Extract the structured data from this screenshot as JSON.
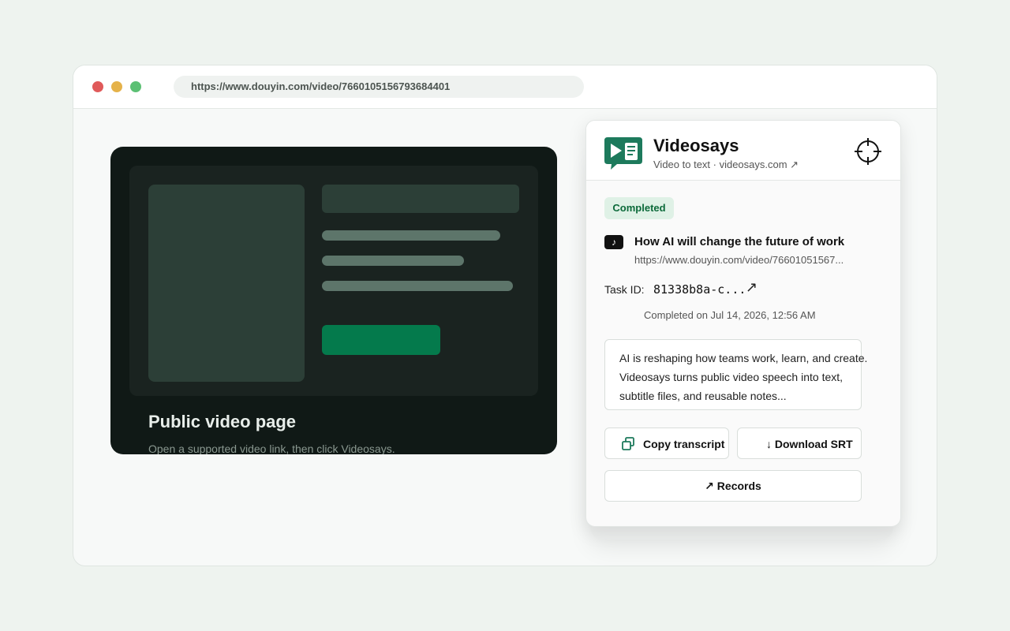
{
  "browser": {
    "url": "https://www.douyin.com/video/7660105156793684401"
  },
  "page": {
    "title": "Public video page",
    "subtitle": "Open a supported video link, then click Videosays."
  },
  "extension": {
    "brand_name": "Videosays",
    "brand_sub": "Video to text · videosays.com ↗",
    "status": "Completed",
    "source_icon": "♪",
    "video_title": "How AI will change the future of work",
    "video_url": "https://www.douyin.com/video/76601051567...",
    "task_label": "Task ID:",
    "task_id": "81338b8a-c...",
    "task_link_icon": "↗",
    "completed_on": "Completed on Jul 14, 2026, 12:56 AM",
    "transcript_lines": [
      "AI is reshaping how teams work, learn, and create.",
      "Videosays turns public video speech into text,",
      "subtitle files, and reusable notes..."
    ],
    "copy_label": "Copy transcript",
    "download_label": "↓ Download SRT",
    "records_label": "↗ Records"
  },
  "colors": {
    "accent": "#1d7a5c",
    "cta": "#047a4c",
    "badge_bg": "#dff1e6",
    "badge_text": "#0c6a3a"
  },
  "icons": [
    "videosays-logo-icon",
    "crosshair-icon",
    "tiktok-icon",
    "external-link-icon",
    "copy-icon"
  ]
}
